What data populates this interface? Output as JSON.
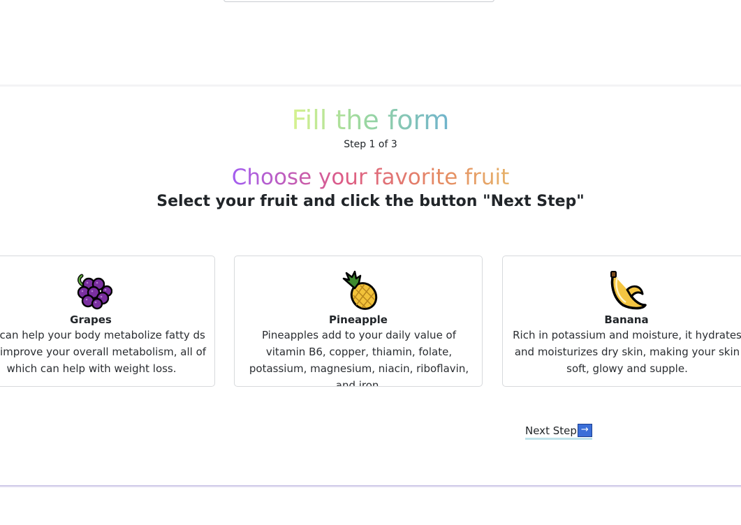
{
  "form": {
    "title": "Fill the form",
    "step_indicator": "Step 1 of 3",
    "question": "Choose your favorite fruit",
    "instructions": "Select your fruit and click the button \"Next Step\""
  },
  "fruits": [
    {
      "name": "Grapes",
      "icon": "grapes-icon",
      "description": "pes can help your body metabolize fatty ds and improve your overall metabolism, all of which can help with weight loss."
    },
    {
      "name": "Pineapple",
      "icon": "pineapple-icon",
      "description": "Pineapples add to your daily value of vitamin B6, copper, thiamin, folate, potassium, magnesium, niacin, riboflavin, and iron."
    },
    {
      "name": "Banana",
      "icon": "banana-icon",
      "description": "Rich in potassium and moisture, it hydrates and moisturizes dry skin, making your skin soft, glowy and supple."
    }
  ],
  "navigation": {
    "next_label": "Next Step",
    "next_arrow": "→"
  },
  "colors": {
    "title_gradient": [
      "#d6f28f",
      "#9bd8a0",
      "#6fb3cc"
    ],
    "question_gradient": [
      "#a35ef0",
      "#dd5c86",
      "#e58a62",
      "#e6b26a"
    ],
    "arrow_button": "#3b6fd8"
  }
}
